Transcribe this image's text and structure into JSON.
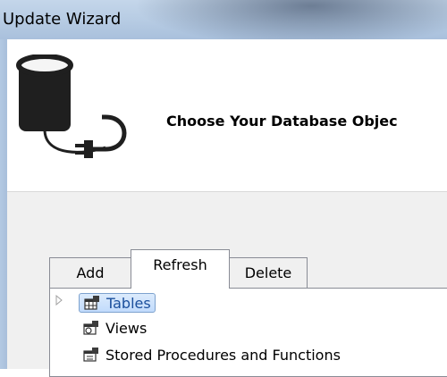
{
  "window": {
    "title": "Update Wizard"
  },
  "header": {
    "heading": "Choose Your Database Objec"
  },
  "tabs": [
    {
      "label": "Add"
    },
    {
      "label": "Refresh",
      "selected": true
    },
    {
      "label": "Delete"
    }
  ],
  "tree": {
    "items": [
      {
        "label": "Tables",
        "icon": "table-icon",
        "selected": true,
        "expander": "collapsed"
      },
      {
        "label": "Views",
        "icon": "view-icon"
      },
      {
        "label": "Stored Procedures and Functions",
        "icon": "procedure-icon"
      }
    ]
  },
  "colors": {
    "title_bar": "#b6cbe3",
    "selection": "#c1dbfc",
    "tab_border": "#898c95"
  }
}
